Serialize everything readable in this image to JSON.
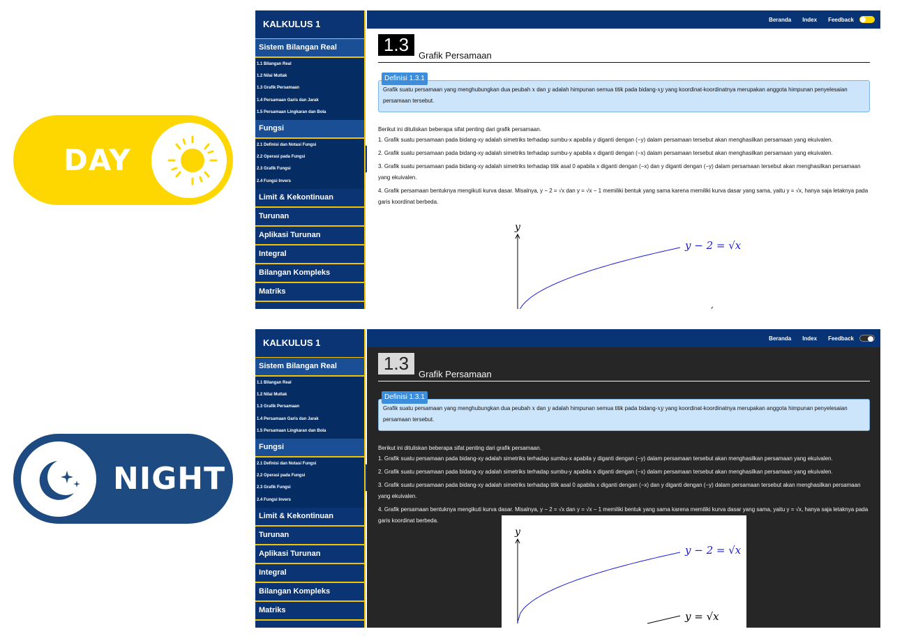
{
  "toggles": {
    "day": {
      "label": "DAY",
      "bg": "#ffd700"
    },
    "night": {
      "label": "NIGHT",
      "bg": "#1d4a80"
    }
  },
  "app": {
    "brand": "KALKULUS 1",
    "top_nav": [
      "Beranda",
      "Index",
      "Feedback"
    ],
    "collapse_glyph": "«",
    "sidebar": [
      {
        "label": "Sistem Bilangan Real",
        "items": [
          "1.1 Bilangan Real",
          "1.2 Nilai Mutlak",
          "1.3 Grafik Persamaan",
          "1.4 Persamaan Garis dan Jarak",
          "1.5 Persamaan Lingkaran dan Bola"
        ]
      },
      {
        "label": "Fungsi",
        "items": [
          "2.1 Definisi dan Notasi Fungsi",
          "2.2 Operasi pada Fungsi",
          "2.3 Grafik Fungsi",
          "2.4 Fungsi Invers"
        ]
      },
      {
        "label": "Limit & Kekontinuan",
        "items": []
      },
      {
        "label": "Turunan",
        "items": []
      },
      {
        "label": "Aplikasi Turunan",
        "items": []
      },
      {
        "label": "Integral",
        "items": []
      },
      {
        "label": "Bilangan Kompleks",
        "items": []
      },
      {
        "label": "Matriks",
        "items": []
      }
    ],
    "section_number": "1.3",
    "section_title": "Grafik Persamaan",
    "definition": {
      "label": "Definisi 1.3.1",
      "p1": "Grafik suatu persamaan yang menghubungkan dua peubah ",
      "x": "x",
      "p2": " dan ",
      "y": "y",
      "p3": " adalah himpunan semua titik pada bidang-",
      "xy": "xy",
      "p4": " yang koordinat-koordinatnya merupakan anggota himpunan penyelesaian persamaan tersebut."
    },
    "intro": "Berikut ini dituliskan beberapa sifat penting dari grafik persamaan.",
    "properties": [
      "1. Grafik suatu persamaan pada bidang-xy adalah simetriks terhadap sumbu-x apabila y diganti dengan (−y) dalam persamaan tersebut akan menghasilkan persamaan yang ekuivalen.",
      "2. Grafik suatu persamaan pada bidang-xy adalah simetriks terhadap sumbu-y apabila x diganti dengan (−x) dalam persamaan tersebut akan menghasilkan persamaan yang ekuivalen.",
      "3. Grafik suatu persamaan pada bidang-xy adalah simetriks terhadap titik asal 0 apabila x diganti dengan (−x) dan y diganti dengan (−y) dalam persamaan tersebut akan menghasilkan persamaan yang ekuivalen.",
      "4. Grafik persamaan bentuknya mengikuti kurva dasar. Misalnya, y − 2 = √x dan y = √x − 1 memiliki bentuk yang sama karena memiliki kurva dasar yang sama, yaitu y = √x, hanya saja letaknya pada garis koordinat berbeda."
    ],
    "graph": {
      "axis_label": "y",
      "curve1_label": "y − 2 = √x",
      "curve2_label": "y = √x",
      "curve1_color": "#1a1adc"
    }
  }
}
